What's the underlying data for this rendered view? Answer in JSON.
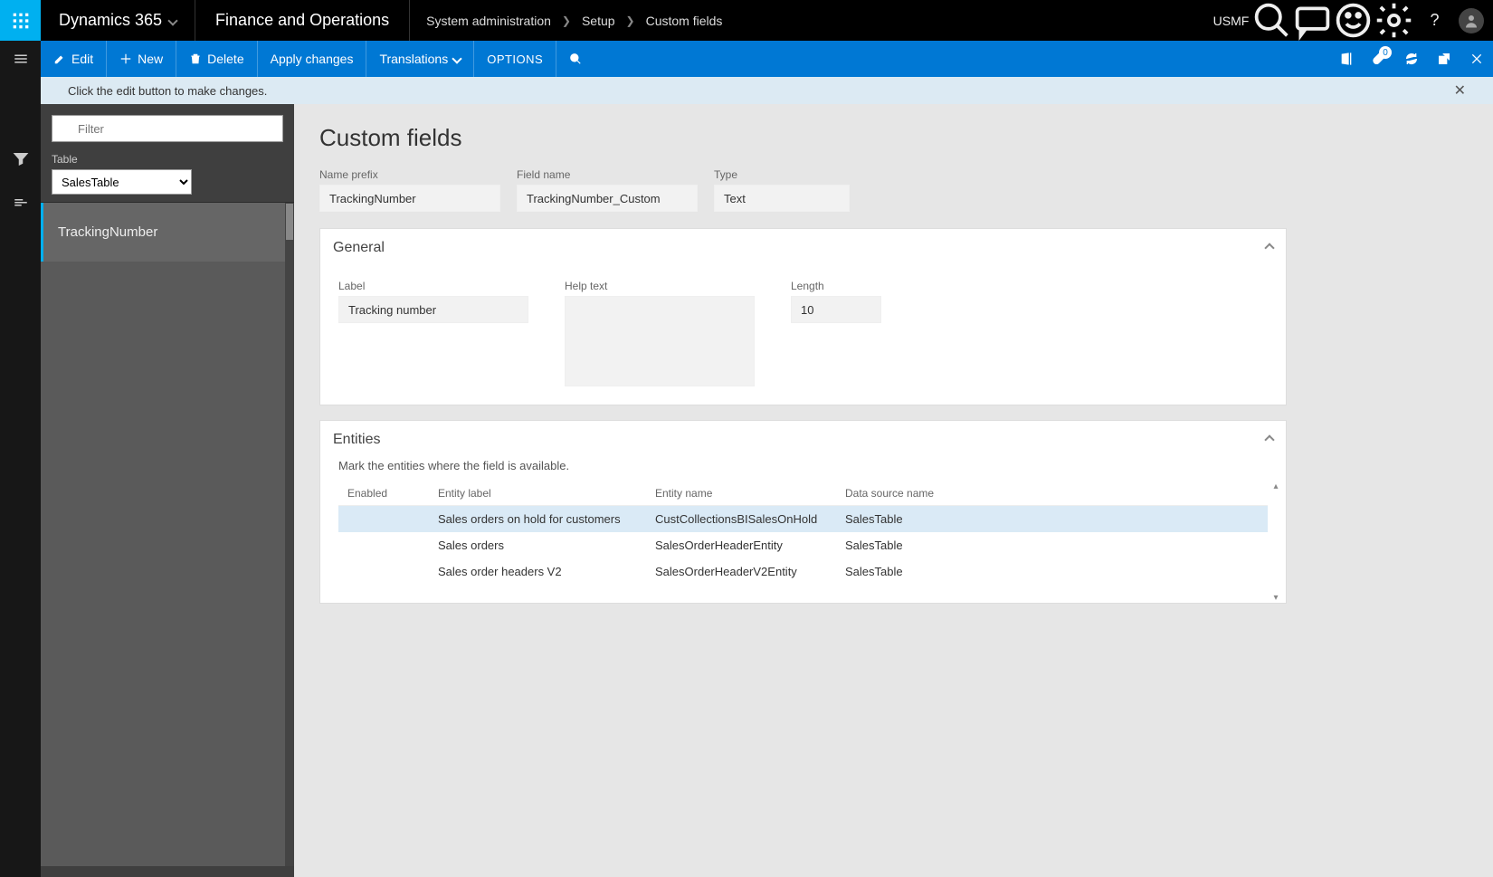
{
  "top": {
    "brand": "Dynamics 365",
    "module": "Finance and Operations",
    "breadcrumb": [
      "System administration",
      "Setup",
      "Custom fields"
    ],
    "legal_entity": "USMF"
  },
  "actionbar": {
    "edit": "Edit",
    "new": "New",
    "delete": "Delete",
    "apply": "Apply changes",
    "translations": "Translations",
    "options": "OPTIONS",
    "badge": "0"
  },
  "info": {
    "text": "Click the edit button to make changes."
  },
  "left": {
    "filter_placeholder": "Filter",
    "table_label": "Table",
    "table_value": "SalesTable",
    "items": [
      "TrackingNumber"
    ]
  },
  "page": {
    "title": "Custom fields",
    "name_prefix_label": "Name prefix",
    "name_prefix": "TrackingNumber",
    "field_name_label": "Field name",
    "field_name": "TrackingNumber_Custom",
    "type_label": "Type",
    "type": "Text"
  },
  "general": {
    "title": "General",
    "label_label": "Label",
    "label": "Tracking number",
    "help_label": "Help text",
    "help": "",
    "length_label": "Length",
    "length": "10"
  },
  "entities": {
    "title": "Entities",
    "note": "Mark the entities where the field is available.",
    "cols": {
      "enabled": "Enabled",
      "label": "Entity label",
      "name": "Entity name",
      "ds": "Data source name"
    },
    "rows": [
      {
        "label": "Sales orders on hold for customers",
        "name": "CustCollectionsBISalesOnHold",
        "ds": "SalesTable",
        "selected": true
      },
      {
        "label": "Sales orders",
        "name": "SalesOrderHeaderEntity",
        "ds": "SalesTable",
        "selected": false
      },
      {
        "label": "Sales order headers V2",
        "name": "SalesOrderHeaderV2Entity",
        "ds": "SalesTable",
        "selected": false
      }
    ]
  }
}
